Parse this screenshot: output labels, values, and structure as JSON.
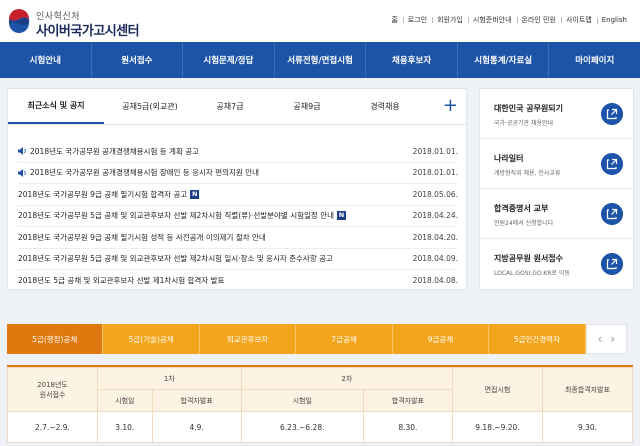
{
  "header": {
    "org_small": "인사혁신처",
    "org_name": "사이버국가고시센터",
    "utility": [
      "홈",
      "로그인",
      "회원가입",
      "시험준비안내",
      "온라인 민원",
      "사이트맵",
      "English"
    ]
  },
  "gnb": [
    "시험안내",
    "원서접수",
    "시험문제/정답",
    "서류전형/면접시험",
    "채용후보자",
    "시험통계/자료실",
    "마이페이지"
  ],
  "notice": {
    "tabs": [
      "최근소식 및 공지",
      "공채5급(외교관)",
      "공채7급",
      "공채9급",
      "경력채용"
    ],
    "plus": "+",
    "items": [
      {
        "title": "2018년도 국가공무원 공개경쟁채용시험 등 계획 공고",
        "date": "2018.01.01.",
        "speaker": true,
        "new": false
      },
      {
        "title": "2018년도 국가공무원 공개경쟁채용시험 장애인 등 응시자 편의지원 안내",
        "date": "2018.01.01.",
        "speaker": true,
        "new": false
      },
      {
        "title": "2018년도 국가공무원 9급 공채 필기시험 합격자 공고",
        "date": "2018.05.06.",
        "speaker": false,
        "new": true
      },
      {
        "title": "2018년도 국가공무원 5급 공채 및 외교관후보자 선발 제2차시험 직렬(류)·선발분야별 시험일정 안내",
        "date": "2018.04.24.",
        "speaker": false,
        "new": true
      },
      {
        "title": "2018년도 국가공무원 9급 공채 필기시험 성적 등 사전공개 이의제기 절차 안내",
        "date": "2018.04.20.",
        "speaker": false,
        "new": false
      },
      {
        "title": "2018년도 국가공무원 5급 공채 및 외교관후보자 선발 제2차시험 일시·장소 및 응시자 준수사항 공고",
        "date": "2018.04.09.",
        "speaker": false,
        "new": false
      },
      {
        "title": "2018년도 5급 공채 및 외교관후보자 선발 제1차시험 합격자 발표",
        "date": "2018.04.08.",
        "speaker": false,
        "new": false
      }
    ],
    "new_badge": "N"
  },
  "quick": [
    {
      "title": "대한민국 공무원되기",
      "sub": "국가·공공기관 채용안내"
    },
    {
      "title": "나라일터",
      "sub": "개방형직위 채용, 인사교류"
    },
    {
      "title": "합격증명서 교부",
      "sub": "민원24에서 신청합니다"
    },
    {
      "title": "지방공무원 원서접수",
      "sub": "LOCAL.GOSI.GO.KR로 이동"
    }
  ],
  "exam_tabs": [
    "5급(행정)공채",
    "5급(기술)공채",
    "외교관후보자",
    "7급공채",
    "9급공채",
    "5급민간경력자"
  ],
  "exam_arrows": {
    "prev": "‹",
    "next": "›"
  },
  "schedule": {
    "header1": {
      "year": "2018년도",
      "reg": "원서접수",
      "first": "1차",
      "second": "2차",
      "interview": "면접시험",
      "final": "최종합격자발표"
    },
    "header2": [
      "시험일",
      "합격자발표",
      "시험일",
      "합격자발표"
    ],
    "values": [
      "2.7.~2.9.",
      "3.10.",
      "4.9.",
      "6.23.~6.28.",
      "8.30.",
      "9.18.~9.20.",
      "9.30."
    ]
  }
}
